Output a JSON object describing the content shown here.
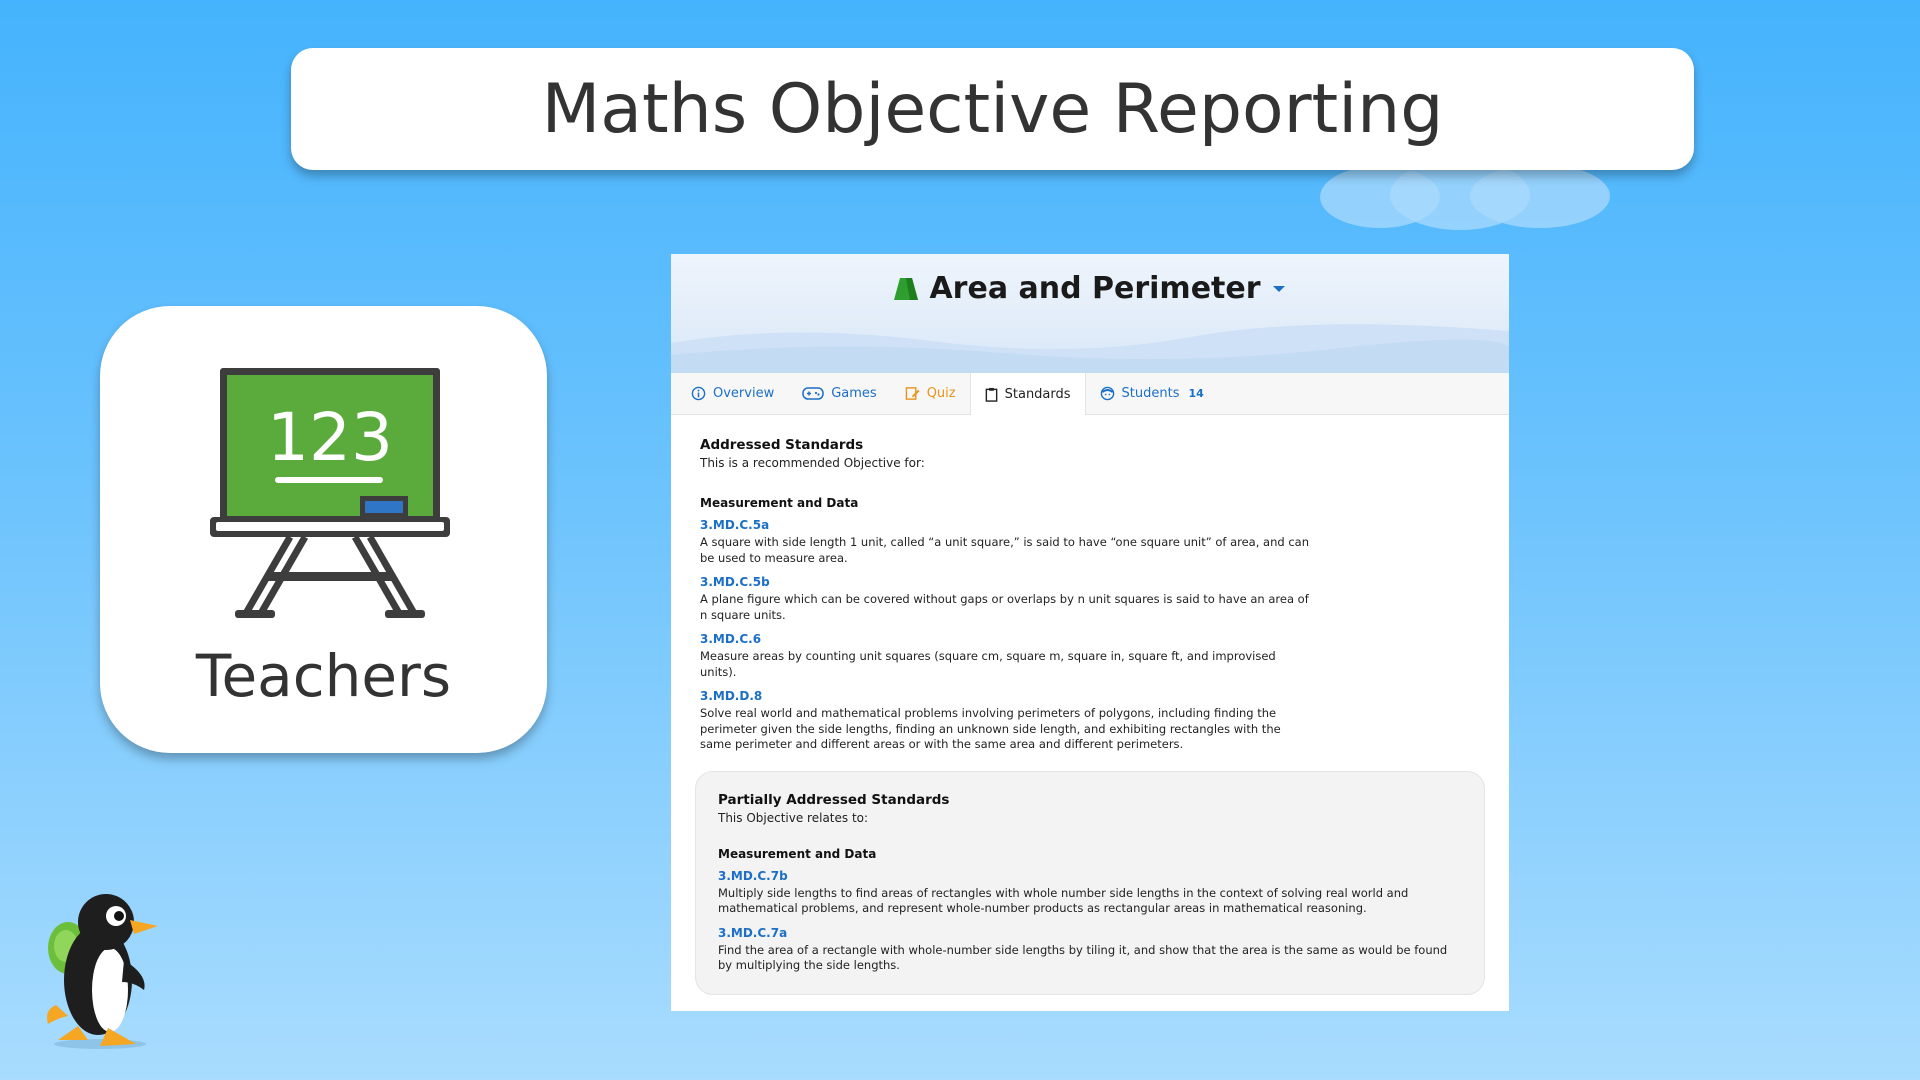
{
  "slide": {
    "title": "Maths Objective Reporting",
    "teacher_label": "Teachers",
    "board_number": "123"
  },
  "panel": {
    "objective_title": "Area and Perimeter",
    "tabs": [
      {
        "label": "Overview",
        "icon": "info-icon"
      },
      {
        "label": "Games",
        "icon": "gamepad-icon"
      },
      {
        "label": "Quiz",
        "icon": "quiz-icon"
      },
      {
        "label": "Standards",
        "icon": "clipboard-icon",
        "active": true
      },
      {
        "label": "Students",
        "icon": "student-icon",
        "count": "14"
      }
    ],
    "addressed": {
      "title": "Addressed Standards",
      "subtitle": "This is a recommended Objective for:",
      "domain": "Measurement and Data",
      "standards": [
        {
          "code": "3.MD.C.5a",
          "desc": "A square with side length 1 unit, called “a unit square,” is said to have “one square unit” of area, and can be used to measure area."
        },
        {
          "code": "3.MD.C.5b",
          "desc": "A plane figure which can be covered without gaps or overlaps by n unit squares is said to have an area of n square units."
        },
        {
          "code": "3.MD.C.6",
          "desc": "Measure areas by counting unit squares (square cm, square m, square in, square ft, and improvised units)."
        },
        {
          "code": "3.MD.D.8",
          "desc": "Solve real world and mathematical problems involving perimeters of polygons, including finding the perimeter given the side lengths, finding an unknown side length, and exhibiting rectangles with the same perimeter and different areas or with the same area and different perimeters."
        }
      ]
    },
    "partial": {
      "title": "Partially Addressed Standards",
      "subtitle": "This Objective relates to:",
      "domain": "Measurement and Data",
      "standards": [
        {
          "code": "3.MD.C.7b",
          "desc": "Multiply side lengths to find areas of rectangles with whole number side lengths in the context of solving real world and mathematical problems, and represent whole-number products as rectangular areas in mathematical reasoning."
        },
        {
          "code": "3.MD.C.7a",
          "desc": "Find the area of a rectangle with whole-number side lengths by tiling it, and show that the area is the same as would be found by multiplying the side lengths."
        }
      ]
    }
  },
  "colors": {
    "link_blue": "#1c6fc7",
    "quiz_orange": "#e8941c",
    "board_green": "#5aaa3c",
    "objective_green": "#2e9e2e"
  }
}
